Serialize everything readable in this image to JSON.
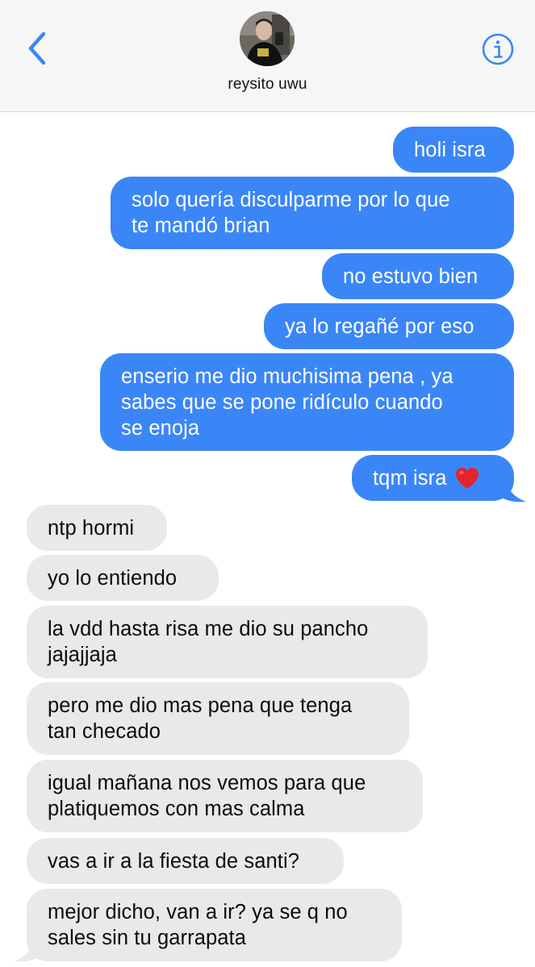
{
  "header": {
    "contact_name": "reysito uwu",
    "back_icon": "chevron-left-icon",
    "info_icon": "info-icon",
    "accent_color": "#3b86f7"
  },
  "messages": [
    {
      "direction": "sent",
      "text": "holi isra"
    },
    {
      "direction": "sent",
      "text": "solo quería disculparme por lo que\nte mandó brian"
    },
    {
      "direction": "sent",
      "text": "no estuvo bien"
    },
    {
      "direction": "sent",
      "text": "ya lo regañé por eso"
    },
    {
      "direction": "sent",
      "text": "enserio me dio muchisima pena , ya\nsabes que se pone ridículo cuando\nse enoja"
    },
    {
      "direction": "sent",
      "text": "tqm isra",
      "emoji": "red-heart-icon"
    },
    {
      "direction": "received",
      "text": "ntp hormi"
    },
    {
      "direction": "received",
      "text": "yo lo entiendo"
    },
    {
      "direction": "received",
      "text": "la vdd hasta risa me dio su pancho\njajajjaja"
    },
    {
      "direction": "received",
      "text": "pero me dio mas pena que tenga\ntan checado"
    },
    {
      "direction": "received",
      "text": "igual mañana nos vemos para que\nplatiquemos con mas calma"
    },
    {
      "direction": "received",
      "text": "vas a ir a la fiesta de santi?"
    },
    {
      "direction": "received",
      "text": "mejor dicho, van a ir? ya se q no\nsales sin tu garrapata"
    }
  ]
}
